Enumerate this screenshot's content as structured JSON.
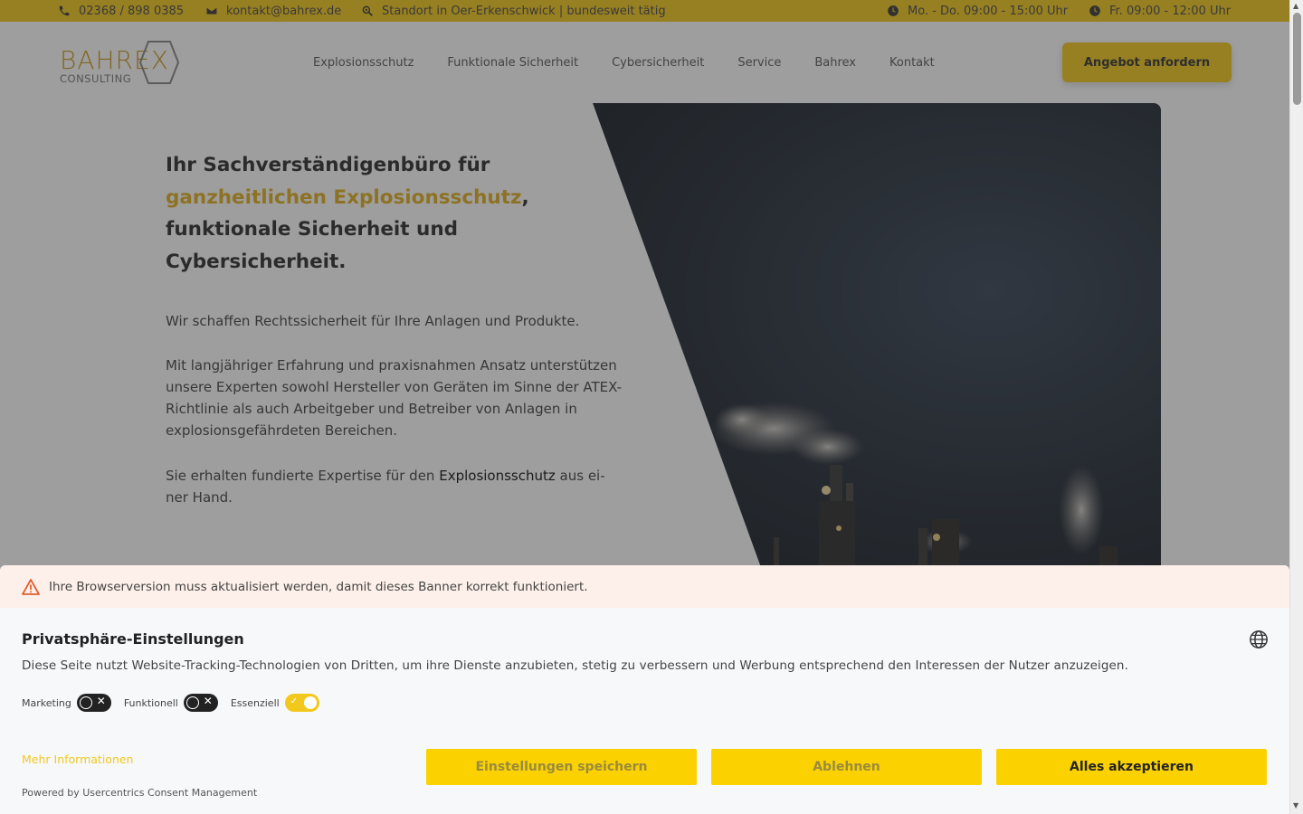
{
  "topbar": {
    "phone": "02368 / 898 0385",
    "email": "kontakt@bahrex.de",
    "location": "Standort in Oer-Erkenschwick | bundesweit tätig",
    "hours_weekday": "Mo. - Do. 09:00 - 15:00 Uhr",
    "hours_friday": "Fr. 09:00 - 12:00 Uhr"
  },
  "logo": {
    "word": "BAHREX",
    "sub": "CONSULTING"
  },
  "nav": {
    "items": [
      "Explosionsschutz",
      "Funktionale Sicherheit",
      "Cybersicherheit",
      "Service",
      "Bahrex",
      "Kontakt"
    ],
    "cta": "Angebot anfordern"
  },
  "hero": {
    "title_start": "Ihr Sachverständigenbüro für",
    "title_accent": "ganzheitlichen Explosionsschutz",
    "title_end": ", funktionale Sicherheit und Cybersicherheit.",
    "para1": "Wir schaffen Rechtssicherheit für Ihre Anlagen und Produkte.",
    "para2": "Mit langjähriger Erfahrung und praxisnahmen Ansatz unterstützen unsere Experten sowohl Hersteller von Geräten im Sinne der ATEX-Richtlinie als auch Arbeitgeber und Betreiber von Anlagen in explosionsgefährdeten Bereichen.",
    "para3_start": "Sie erhalten fundierte Expertise für den ",
    "para3_link": "Explosionsschutz",
    "para3_end": " aus ei-ner Hand."
  },
  "consent": {
    "warning": "Ihre Browserversion muss aktualisiert werden, damit dieses Banner korrekt funktioniert.",
    "title": "Privatsphäre-Einstellungen",
    "description": "Diese Seite nutzt Website-Tracking-Technologien von Dritten, um ihre Dienste anzubieten, stetig zu verbessern und Werbung entsprechend den Interessen der Nutzer anzuzeigen.",
    "toggles": [
      {
        "label": "Marketing",
        "on": false
      },
      {
        "label": "Funktionell",
        "on": false
      },
      {
        "label": "Essenziell",
        "on": true
      }
    ],
    "more_info": "Mehr Informationen",
    "powered_by": "Powered by Usercentrics Consent Management",
    "btn_save": "Einstellungen speichern",
    "btn_deny": "Ablehnen",
    "btn_accept": "Alles akzeptieren"
  },
  "colors": {
    "brand": "#f2c81d",
    "button": "#fbd200",
    "accent_text": "#e0b020"
  }
}
